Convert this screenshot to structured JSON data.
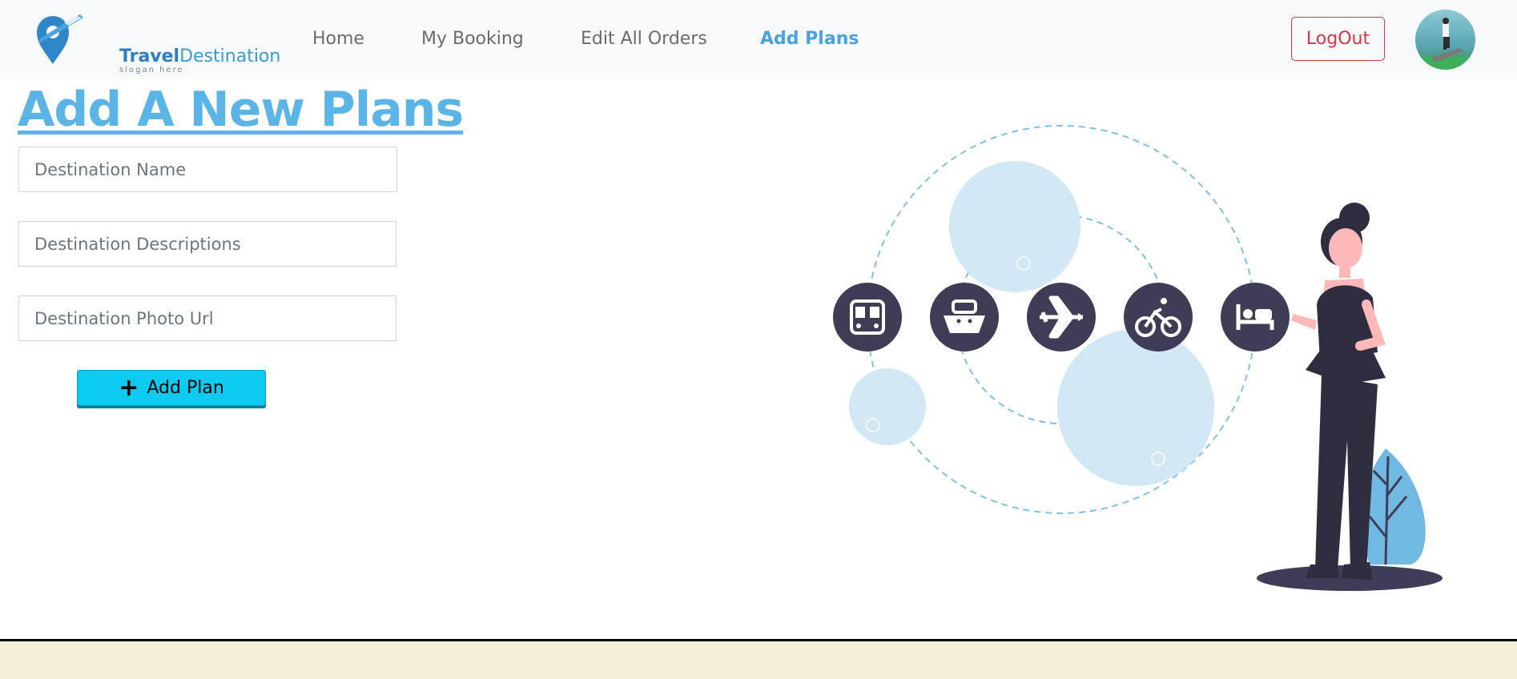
{
  "brand": {
    "name_bold": "Travel",
    "name_light": "Destination",
    "slogan": "slogan here"
  },
  "nav": {
    "links": [
      "Home",
      "My Booking",
      "Edit All Orders",
      "Add Plans"
    ],
    "logout_label": "LogOut"
  },
  "page": {
    "title": "Add A New Plans"
  },
  "form": {
    "name_placeholder": "Destination Name",
    "description_placeholder": "Destination Descriptions",
    "photo_placeholder": "Destination Photo Url",
    "submit_label": "Add Plan"
  },
  "illustration": {
    "icons": [
      "bus-icon",
      "ship-icon",
      "airplane-icon",
      "bicycle-icon",
      "bed-icon"
    ]
  },
  "colors": {
    "accent": "#4aa3df",
    "button": "#0dcaf0",
    "logout": "#dc3545",
    "navbar": "#f8f9fa",
    "footer": "#f5efd7"
  }
}
